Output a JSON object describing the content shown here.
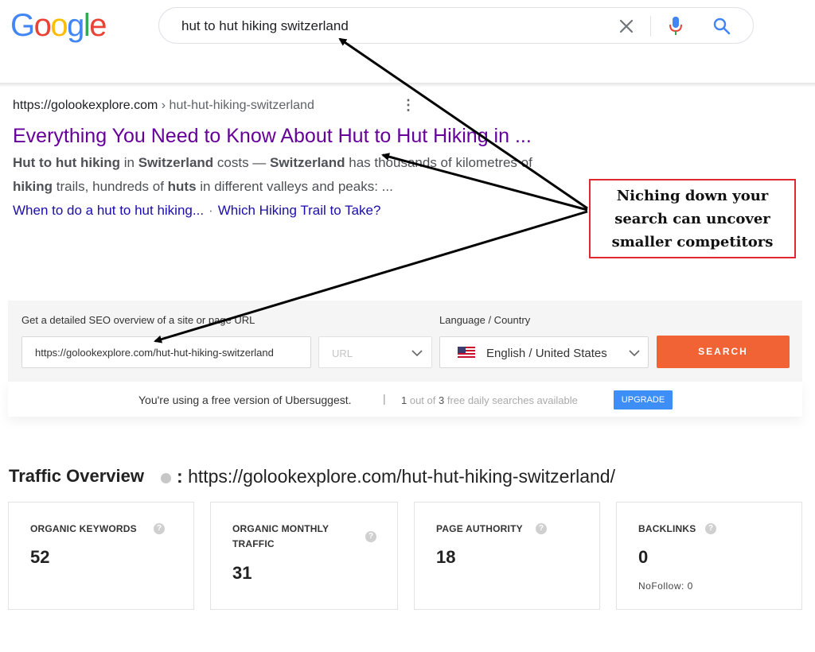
{
  "google": {
    "logo_letters": [
      {
        "ch": "G",
        "color": "#4285F4"
      },
      {
        "ch": "o",
        "color": "#EA4335"
      },
      {
        "ch": "o",
        "color": "#FBBC05"
      },
      {
        "ch": "g",
        "color": "#4285F4"
      },
      {
        "ch": "l",
        "color": "#34A853"
      },
      {
        "ch": "e",
        "color": "#EA4335"
      }
    ],
    "query": "hut to hut hiking switzerland",
    "icons": [
      "close-icon",
      "microphone-icon",
      "search-icon"
    ]
  },
  "result": {
    "cite_domain": "https://golookexplore.com",
    "cite_path": " › hut-hut-hiking-switzerland",
    "more_icon": "⋮",
    "title": "Everything You Need to Know About Hut to Hut Hiking in ...",
    "snippet_html_parts": [
      {
        "b": "Hut to hut hiking"
      },
      {
        "t": " in "
      },
      {
        "b": "Switzerland"
      },
      {
        "t": " costs — "
      },
      {
        "b": "Switzerland"
      },
      {
        "t": " has thousands of kilometres of "
      },
      {
        "br": true
      },
      {
        "b": "hiking"
      },
      {
        "t": " trails, hundreds of "
      },
      {
        "b": "huts"
      },
      {
        "t": " in different valleys and peaks: ..."
      }
    ],
    "sitelink_1": "When to do a hut to hut hiking...",
    "sitelink_sep": "·",
    "sitelink_2": "Which Hiking Trail to Take?"
  },
  "annotation": {
    "lines": [
      "Niching down your",
      "search can uncover",
      "smaller competitors"
    ],
    "border_color": "#e0282e"
  },
  "ubersuggest": {
    "url_label": "Get a detailed SEO overview of a site or page URL",
    "url_value": "https://golookexplore.com/hut-hut-hiking-switzerland",
    "type_placeholder": "URL",
    "lang_label": "Language / Country",
    "lang_value": "English / United States",
    "search_button": "SEARCH",
    "free_msg": "You're using a free version of Ubersuggest.",
    "pipe": "|",
    "quota_used": "1",
    "quota_mid": " out of ",
    "quota_total": "3",
    "quota_tail": " free daily searches available",
    "upgrade_button": "UPGRADE",
    "accent": "#f16334",
    "upgrade_color": "#3e8ef7"
  },
  "traffic": {
    "title": "Traffic Overview",
    "colon": ":",
    "url": "https://golookexplore.com/hut-hut-hiking-switzerland/",
    "help_glyph": "?",
    "cards": [
      {
        "label": "ORGANIC KEYWORDS",
        "value": "52",
        "sub": ""
      },
      {
        "label": "ORGANIC MONTHLY TRAFFIC",
        "value": "31",
        "sub": ""
      },
      {
        "label": "PAGE AUTHORITY",
        "value": "18",
        "sub": ""
      },
      {
        "label": "BACKLINKS",
        "value": "0",
        "sub": "NoFollow: 0"
      }
    ]
  }
}
